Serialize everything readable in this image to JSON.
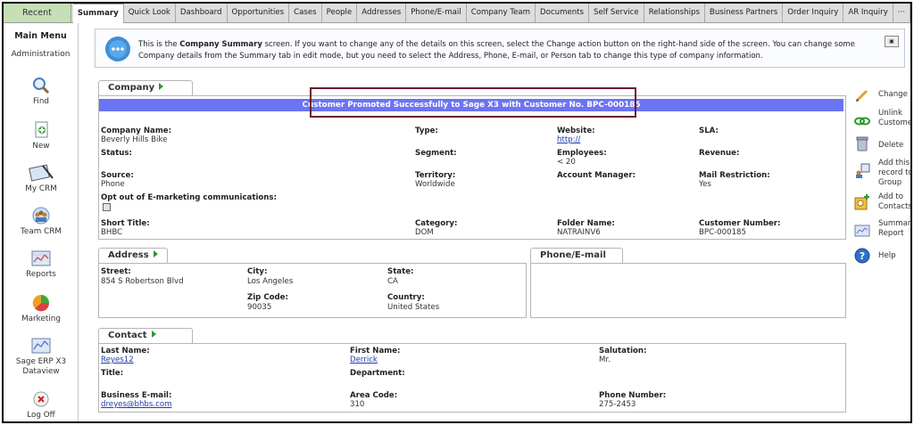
{
  "topbar": {
    "recent": "Recent",
    "tabs": [
      "Summary",
      "Quick Look",
      "Dashboard",
      "Opportunities",
      "Cases",
      "People",
      "Addresses",
      "Phone/E-mail",
      "Company Team",
      "Documents",
      "Self Service",
      "Relationships",
      "Business Partners",
      "Order Inquiry",
      "AR Inquiry",
      "···"
    ],
    "active": "Summary"
  },
  "sidebar": {
    "main_menu": "Main Menu",
    "administration": "Administration",
    "items": [
      {
        "label": "Find",
        "icon": "magnifier-icon"
      },
      {
        "label": "New",
        "icon": "new-document-icon"
      },
      {
        "label": "My CRM",
        "icon": "my-crm-icon"
      },
      {
        "label": "Team CRM",
        "icon": "team-icon"
      },
      {
        "label": "Reports",
        "icon": "reports-icon"
      },
      {
        "label": "Marketing",
        "icon": "marketing-icon"
      },
      {
        "label": "Sage ERP X3 Dataview",
        "icon": "dataview-icon"
      },
      {
        "label": "Log Off",
        "icon": "log-off-icon"
      }
    ]
  },
  "info": {
    "prefix": "This is the ",
    "bold": "Company Summary",
    "suffix": " screen. If you want to change any of the details on this screen, select the Change action button on the right-hand side of the screen. You can change some Company details from the Summary tab in edit mode, but you need to select the Address, Phone, E-mail, or Person tab to change this type of company information."
  },
  "company": {
    "tab_label": "Company",
    "success_message": "Customer Promoted Successfully to Sage X3 with Customer No. BPC-000185",
    "fields": {
      "company_name_label": "Company Name:",
      "company_name": "Beverly Hills Bike",
      "type_label": "Type:",
      "website_label": "Website:",
      "website": "http://",
      "sla_label": "SLA:",
      "status_label": "Status:",
      "segment_label": "Segment:",
      "employees_label": "Employees:",
      "employees": "< 20",
      "revenue_label": "Revenue:",
      "source_label": "Source:",
      "source": "Phone",
      "territory_label": "Territory:",
      "territory": "Worldwide",
      "account_manager_label": "Account Manager:",
      "mail_restriction_label": "Mail Restriction:",
      "mail_restriction": "Yes",
      "opt_out_label": "Opt out of E-marketing communications:",
      "short_title_label": "Short Title:",
      "short_title": "BHBC",
      "category_label": "Category:",
      "category": "DOM",
      "folder_name_label": "Folder Name:",
      "folder_name": "NATRAINV6",
      "customer_number_label": "Customer Number:",
      "customer_number": "BPC-000185"
    }
  },
  "address": {
    "tab_label": "Address",
    "street_label": "Street:",
    "street": "854 S Robertson Blvd",
    "city_label": "City:",
    "city": "Los Angeles",
    "state_label": "State:",
    "state": "CA",
    "zip_label": "Zip Code:",
    "zip": "90035",
    "country_label": "Country:",
    "country": "United States"
  },
  "phone_email": {
    "tab_label": "Phone/E-mail"
  },
  "contact": {
    "tab_label": "Contact",
    "last_name_label": "Last Name:",
    "last_name": "Reyes12",
    "first_name_label": "First Name:",
    "first_name": "Derrick",
    "salutation_label": "Salutation:",
    "salutation": "Mr.",
    "title_label": "Title:",
    "department_label": "Department:",
    "business_email_label": "Business E-mail:",
    "business_email": "dreyes@bhbs.com",
    "area_code_label": "Area Code:",
    "area_code": "310",
    "phone_number_label": "Phone Number:",
    "phone_number": "275-2453"
  },
  "actions": [
    {
      "label": "Change",
      "icon": "pencil-icon"
    },
    {
      "label": "Unlink Customer",
      "icon": "unlink-icon"
    },
    {
      "label": "Delete",
      "icon": "trash-icon"
    },
    {
      "label": "Add this record to Group",
      "icon": "add-group-icon"
    },
    {
      "label": "Add to Contacts",
      "icon": "add-contact-icon"
    },
    {
      "label": "Summary Report",
      "icon": "summary-report-icon"
    },
    {
      "label": "Help",
      "icon": "help-icon"
    }
  ],
  "colors": {
    "success_bar": "#6b74f3",
    "recent_tab": "#c6dfb6",
    "highlight_border": "#6b1d2b",
    "link": "#1a3fa8"
  }
}
